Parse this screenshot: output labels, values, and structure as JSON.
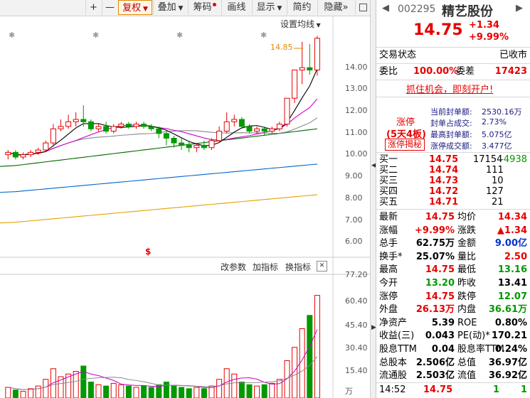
{
  "toolbar": {
    "plus": "+",
    "minus": "—",
    "buttons": [
      "复权",
      "叠加",
      "筹码",
      "画线",
      "显示",
      "简约",
      "隐藏"
    ],
    "more": "»"
  },
  "chart": {
    "setting_label": "设置均线",
    "peak_label": "14.85",
    "event_marker": "$",
    "indicator_links": [
      "改参数",
      "加指标",
      "换指标"
    ],
    "close_glyph": "✕",
    "price_ticks": [
      "14.00",
      "13.00",
      "12.00",
      "11.00",
      "10.00",
      "9.00",
      "8.00",
      "7.00",
      "6.00"
    ],
    "volume_ticks": [
      "77.20",
      "60.40",
      "45.40",
      "30.40",
      "15.40",
      "万"
    ]
  },
  "chart_data": {
    "type": "candlestick",
    "y_range": [
      5.5,
      15.5
    ],
    "candles": [
      [
        9.8,
        9.9,
        9.6,
        10.0
      ],
      [
        9.9,
        9.7,
        9.6,
        10.0
      ],
      [
        9.7,
        9.8,
        9.6,
        9.9
      ],
      [
        9.8,
        9.9,
        9.7,
        10.0
      ],
      [
        9.9,
        10.0,
        9.8,
        10.1
      ],
      [
        10.0,
        10.3,
        9.9,
        10.4
      ],
      [
        10.3,
        10.9,
        10.2,
        11.1
      ],
      [
        10.9,
        11.0,
        10.8,
        11.3
      ],
      [
        11.0,
        11.2,
        10.9,
        11.5
      ],
      [
        11.2,
        11.3,
        11.0,
        11.6
      ],
      [
        11.3,
        11.2,
        11.0,
        11.9
      ],
      [
        11.2,
        10.9,
        10.8,
        11.3
      ],
      [
        10.9,
        11.0,
        10.8,
        11.1
      ],
      [
        11.0,
        10.8,
        10.7,
        11.2
      ],
      [
        10.8,
        11.0,
        10.7,
        11.1
      ],
      [
        11.0,
        11.1,
        10.9,
        11.2
      ],
      [
        11.1,
        11.0,
        10.9,
        11.2
      ],
      [
        11.0,
        11.1,
        10.9,
        11.2
      ],
      [
        11.1,
        11.0,
        10.9,
        11.2
      ],
      [
        11.0,
        10.9,
        10.8,
        11.1
      ],
      [
        10.9,
        10.7,
        10.5,
        11.0
      ],
      [
        10.7,
        10.5,
        10.2,
        10.8
      ],
      [
        10.5,
        10.3,
        10.1,
        10.6
      ],
      [
        10.3,
        10.2,
        10.0,
        10.5
      ],
      [
        10.2,
        10.1,
        9.9,
        10.4
      ],
      [
        10.1,
        10.2,
        9.9,
        10.3
      ],
      [
        10.2,
        10.1,
        10.0,
        10.4
      ],
      [
        10.1,
        10.4,
        10.0,
        10.5
      ],
      [
        10.4,
        10.8,
        10.3,
        11.0
      ],
      [
        10.8,
        11.2,
        10.7,
        11.6
      ],
      [
        11.2,
        11.3,
        11.0,
        11.5
      ],
      [
        11.3,
        11.0,
        10.9,
        11.4
      ],
      [
        11.0,
        10.8,
        10.7,
        11.1
      ],
      [
        10.8,
        10.9,
        10.7,
        11.0
      ],
      [
        10.9,
        10.8,
        10.6,
        11.0
      ],
      [
        10.8,
        10.9,
        10.7,
        11.0
      ],
      [
        10.9,
        11.1,
        10.8,
        11.2
      ],
      [
        11.1,
        12.2,
        11.0,
        12.2
      ],
      [
        12.2,
        13.4,
        12.0,
        13.4
      ],
      [
        13.4,
        13.5,
        12.8,
        14.6
      ],
      [
        13.5,
        13.4,
        13.2,
        14.5
      ],
      [
        13.4,
        14.75,
        13.16,
        14.85
      ]
    ],
    "volumes": [
      8,
      6,
      5,
      7,
      9,
      14,
      22,
      16,
      18,
      20,
      24,
      12,
      10,
      9,
      11,
      10,
      9,
      8,
      9,
      8,
      10,
      12,
      9,
      8,
      7,
      8,
      7,
      9,
      14,
      22,
      18,
      12,
      10,
      9,
      10,
      11,
      14,
      28,
      38,
      52,
      62,
      77
    ]
  },
  "colors": {
    "up": "#e60000",
    "down": "#009900",
    "ma5": "#000000",
    "ma10": "#cc00cc",
    "ma20": "#006600",
    "ma30": "#0066cc",
    "ma60": "#e6a000",
    "ma_gray": "#888888"
  },
  "quote": {
    "code": "002295",
    "name": "精艺股份",
    "price": "14.75",
    "change": "+1.34",
    "pct": "+9.99%",
    "state_label": "交易状态",
    "state_value": "已收市",
    "wb_label": "委比",
    "wb_value": "100.00%",
    "wc_label": "委差",
    "wc_value": "17423",
    "promo": "抓住机会，即刻开户!",
    "limit_title": "涨停",
    "limit_days": "(5天4板)",
    "limit_reveal": "涨停揭秘",
    "seal": [
      {
        "label": "当前封单额:",
        "value": "2530.16万"
      },
      {
        "label": "封单占成交:",
        "value": "2.73%"
      },
      {
        "label": "最高封单额:",
        "value": "5.075亿"
      },
      {
        "label": "涨停成交额:",
        "value": "3.477亿"
      }
    ],
    "bids": [
      {
        "label": "买一",
        "price": "14.75",
        "vol": "17154",
        "chg": "-4938"
      },
      {
        "label": "买二",
        "price": "14.74",
        "vol": "111",
        "chg": ""
      },
      {
        "label": "买三",
        "price": "14.73",
        "vol": "10",
        "chg": ""
      },
      {
        "label": "买四",
        "price": "14.72",
        "vol": "127",
        "chg": ""
      },
      {
        "label": "买五",
        "price": "14.71",
        "vol": "21",
        "chg": ""
      }
    ],
    "stats": [
      {
        "l1": "最新",
        "v1": "14.75",
        "c1": "red",
        "l2": "均价",
        "v2": "14.34",
        "c2": "red"
      },
      {
        "l1": "涨幅",
        "v1": "+9.99%",
        "c1": "red",
        "l2": "涨跌",
        "v2": "▲1.34",
        "c2": "red"
      },
      {
        "l1": "总手",
        "v1": "62.75万",
        "c1": "blk",
        "l2": "金额",
        "v2": "9.00亿",
        "c2": "blue"
      },
      {
        "l1": "换手*",
        "v1": "25.07%",
        "c1": "blk",
        "l2": "量比",
        "v2": "2.50",
        "c2": "red"
      },
      {
        "l1": "最高",
        "v1": "14.75",
        "c1": "red",
        "l2": "最低",
        "v2": "13.16",
        "c2": "grn"
      },
      {
        "l1": "今开",
        "v1": "13.20",
        "c1": "grn",
        "l2": "昨收",
        "v2": "13.41",
        "c2": "blk"
      },
      {
        "l1": "涨停",
        "v1": "14.75",
        "c1": "red",
        "l2": "跌停",
        "v2": "12.07",
        "c2": "grn"
      },
      {
        "l1": "外盘",
        "v1": "26.13万",
        "c1": "red",
        "l2": "内盘",
        "v2": "36.61万",
        "c2": "grn"
      },
      {
        "l1": "净资产",
        "v1": "5.39",
        "c1": "blk",
        "l2": "ROE",
        "v2": "0.80%",
        "c2": "blk"
      },
      {
        "l1": "收益(三)",
        "v1": "0.043",
        "c1": "blk",
        "l2": "PE(动)*",
        "v2": "170.21",
        "c2": "blk"
      },
      {
        "l1": "股息TTM",
        "v1": "0.04",
        "c1": "blk",
        "l2": "股息率TTM",
        "v2": "0.24%",
        "c2": "blk"
      },
      {
        "l1": "总股本",
        "v1": "2.506亿",
        "c1": "blk",
        "l2": "总值",
        "v2": "36.97亿",
        "c2": "blk"
      },
      {
        "l1": "流通股",
        "v1": "2.503亿",
        "c1": "blk",
        "l2": "流值",
        "v2": "36.92亿",
        "c2": "blk"
      }
    ],
    "tick": {
      "time": "14:52",
      "price": "14.75",
      "vol": "1",
      "num": "1"
    }
  }
}
